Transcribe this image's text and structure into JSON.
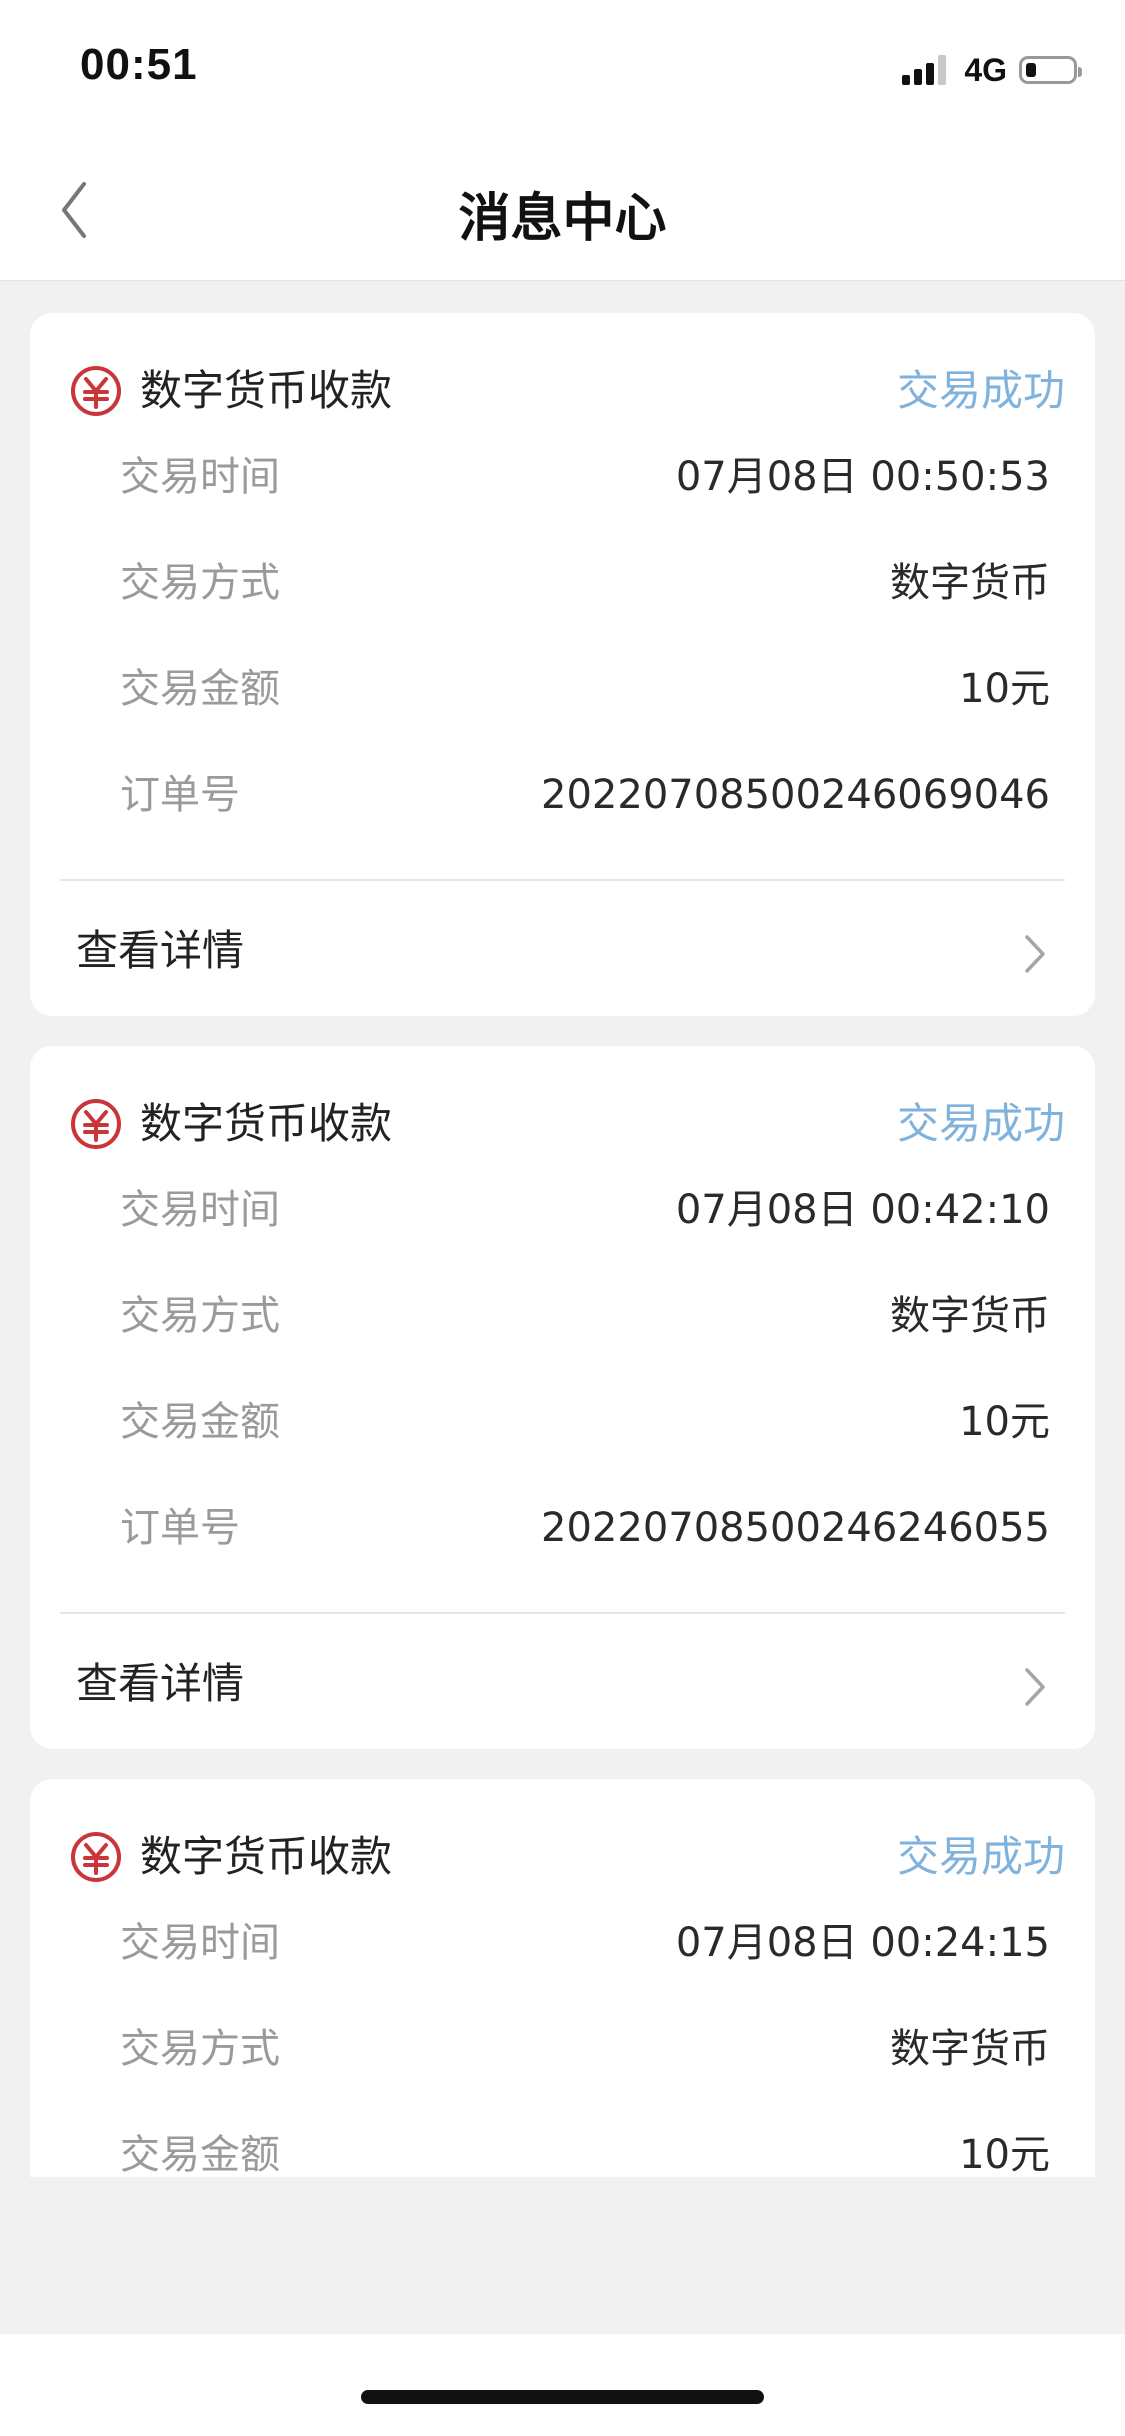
{
  "status_bar": {
    "time": "00:51",
    "network": "4G",
    "signal_bars_active": 3,
    "signal_bars_total": 4,
    "battery_level": 0.2
  },
  "nav": {
    "title": "消息中心",
    "back_icon": "chevron-left-icon"
  },
  "colors": {
    "status_success": "#7fb2dc",
    "rmb_icon": "#c8363a",
    "page_background": "#f1f1f1"
  },
  "messages": [
    {
      "title": "数字货币收款",
      "status": "交易成功",
      "rows": [
        {
          "label": "交易时间",
          "value": "07月08日 00:50:53"
        },
        {
          "label": "交易方式",
          "value": "数字货币"
        },
        {
          "label": "交易金额",
          "value": "10元"
        },
        {
          "label": "订单号",
          "value": "20220708500246069046"
        }
      ],
      "detail_label": "查看详情"
    },
    {
      "title": "数字货币收款",
      "status": "交易成功",
      "rows": [
        {
          "label": "交易时间",
          "value": "07月08日 00:42:10"
        },
        {
          "label": "交易方式",
          "value": "数字货币"
        },
        {
          "label": "交易金额",
          "value": "10元"
        },
        {
          "label": "订单号",
          "value": "20220708500246246055"
        }
      ],
      "detail_label": "查看详情"
    },
    {
      "title": "数字货币收款",
      "status": "交易成功",
      "rows": [
        {
          "label": "交易时间",
          "value": "07月08日 00:24:15"
        },
        {
          "label": "交易方式",
          "value": "数字货币"
        },
        {
          "label": "交易金额",
          "value": "10元"
        }
      ]
    }
  ]
}
